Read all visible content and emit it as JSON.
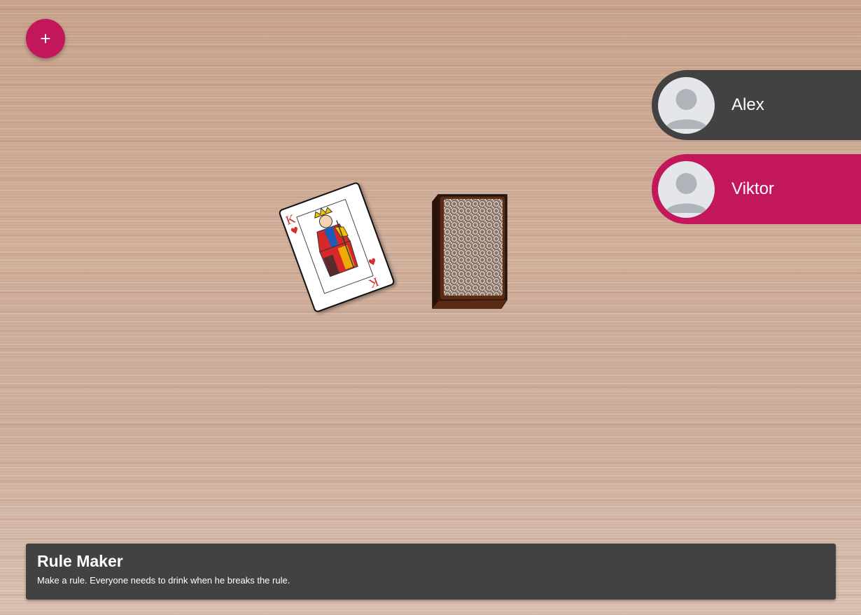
{
  "toolbar": {
    "add_label": "+",
    "add_icon": "plus-icon",
    "accent_color": "#c2185b"
  },
  "players": [
    {
      "name": "Alex",
      "color": "#424242",
      "avatar_icon": "default-avatar-icon",
      "active": false
    },
    {
      "name": "Viktor",
      "color": "#c2185b",
      "avatar_icon": "default-avatar-icon",
      "active": true
    }
  ],
  "table": {
    "current_card": {
      "rank": "K",
      "suit": "♥",
      "suit_name": "hearts",
      "suit_color": "#d32f2f"
    },
    "deck_icon": "card-deck-icon"
  },
  "rule": {
    "title": "Rule Maker",
    "description": "Make a rule. Everyone needs to drink when he breaks the rule."
  }
}
